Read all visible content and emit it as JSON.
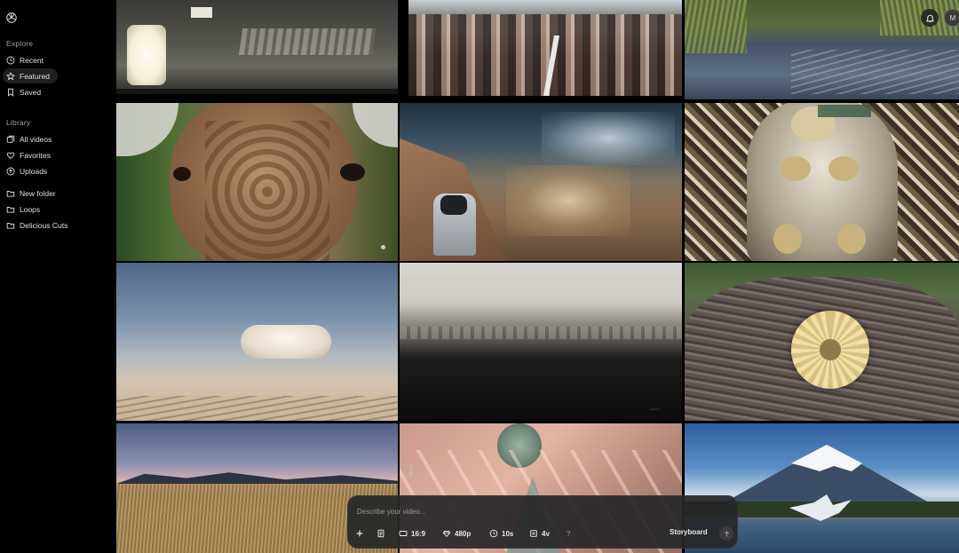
{
  "sidebar": {
    "explore_label": "Explore",
    "explore_items": [
      {
        "label": "Recent",
        "icon": "clock-icon"
      },
      {
        "label": "Featured",
        "icon": "star-icon",
        "active": true
      },
      {
        "label": "Saved",
        "icon": "bookmark-icon"
      }
    ],
    "library_label": "Library",
    "library_items": [
      {
        "label": "All videos",
        "icon": "videos-icon"
      },
      {
        "label": "Favorites",
        "icon": "heart-icon"
      },
      {
        "label": "Uploads",
        "icon": "upload-icon"
      }
    ],
    "folders": [
      {
        "label": "New folder",
        "icon": "folder-icon"
      },
      {
        "label": "Loops",
        "icon": "folder-icon"
      },
      {
        "label": "Delicious Cuts",
        "icon": "folder-icon"
      }
    ]
  },
  "header": {
    "avatar_initial": "M"
  },
  "prompt": {
    "placeholder": "Describe your video...",
    "aspect": "16:9",
    "resolution": "480p",
    "duration": "10s",
    "variations": "4v",
    "help": "?",
    "storyboard": "Storyboard"
  },
  "colors": {
    "background": "#000000",
    "prompt_bar": "#262628",
    "active_nav": "#1e1e1e"
  }
}
